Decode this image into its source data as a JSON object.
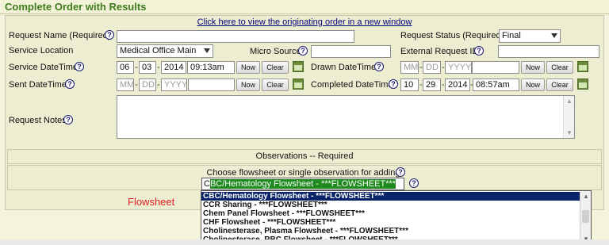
{
  "header": {
    "title": "Complete Order with Results"
  },
  "orig_link": "Click here to view the originating order in a new window",
  "labels": {
    "request_name": "Request Name (Required)",
    "request_status": "Request Status (Required)",
    "service_location": "Service Location",
    "micro_source": "Micro Source",
    "external_request_id": "External Request ID",
    "service_datetime": "Service DateTime",
    "drawn_datetime": "Drawn DateTime",
    "sent_datetime": "Sent DateTime",
    "completed_datetime": "Completed DateTime",
    "request_notes": "Request Notes"
  },
  "fields": {
    "request_status": "Final",
    "service_location": "Medical Office Main",
    "service": {
      "mm": "06",
      "dd": "03",
      "yyyy": "2014",
      "time": "09:13am"
    },
    "drawn": {
      "mm": "MM",
      "dd": "DD",
      "yyyy": "YYYY",
      "time": ""
    },
    "sent": {
      "mm": "MM",
      "dd": "DD",
      "yyyy": "YYYY",
      "time": ""
    },
    "completed": {
      "mm": "10",
      "dd": "29",
      "yyyy": "2014",
      "time": "08:57am"
    },
    "date_sep": "-"
  },
  "buttons": {
    "now": "Now",
    "clear": "Clear"
  },
  "help_glyph": "?",
  "observations": {
    "header": "Observations -- Required",
    "choose_label": "Choose flowsheet or single observation for adding:",
    "combo_typed": "C",
    "combo_highlight": "BC/Hematology Flowsheet - ***FLOWSHEET***",
    "flowsheet_label": "Flowsheet",
    "options": [
      "CBC/Hematology Flowsheet - ***FLOWSHEET***",
      "CCR Sharing - ***FLOWSHEET***",
      "Chem Panel Flowsheet - ***FLOWSHEET***",
      "CHF Flowsheet - ***FLOWSHEET***",
      "Cholinesterase, Plasma Flowsheet - ***FLOWSHEET***",
      "Cholinesterase, RBC Flowsheet - ***FLOWSHEET***"
    ]
  },
  "colors": {
    "title_green": "#3f7a1e",
    "selected_bg": "#0a246a",
    "highlight_green": "#1e8a1e",
    "flowsheet_red": "#d22222"
  }
}
